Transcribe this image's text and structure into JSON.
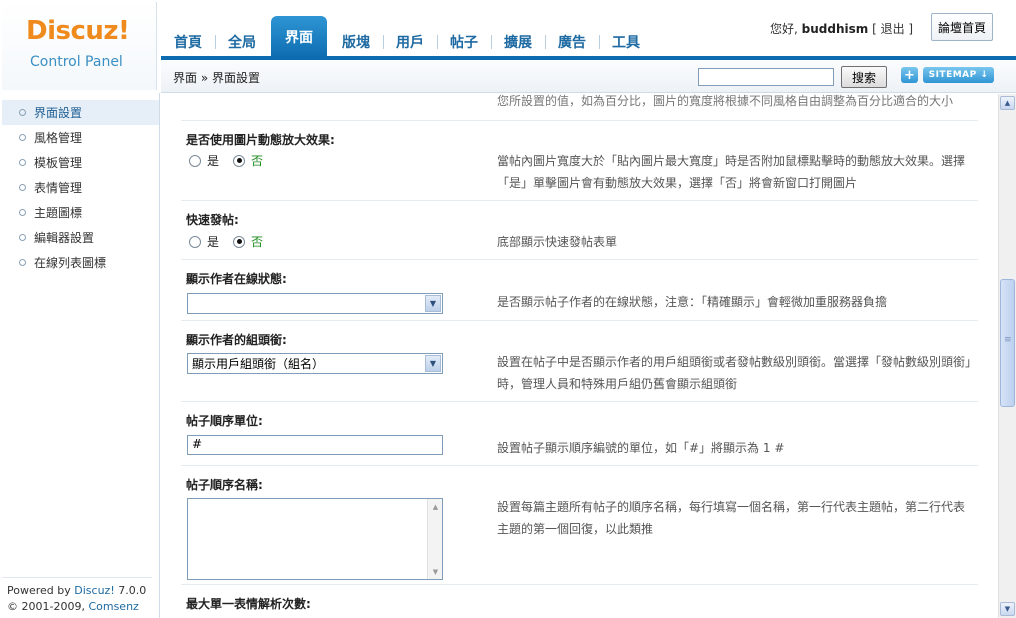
{
  "logo": {
    "word": "Discuz!",
    "subtitle": "Control Panel"
  },
  "nav": {
    "tabs": [
      {
        "label": "首頁"
      },
      {
        "label": "全局"
      },
      {
        "label": "界面",
        "active": true
      },
      {
        "label": "版塊"
      },
      {
        "label": "用戶"
      },
      {
        "label": "帖子"
      },
      {
        "label": "擴展"
      },
      {
        "label": "廣告"
      },
      {
        "label": "工具"
      }
    ]
  },
  "user": {
    "greeting": "您好, ",
    "username": "buddhism",
    "logout": "[ 退出 ]",
    "forum_home": "論壇首頁"
  },
  "breadcrumb": "界面 » 界面設置",
  "search": {
    "value": "",
    "button": "搜索"
  },
  "sitemap": {
    "plus": "+",
    "label": "SITEMAP ↓"
  },
  "sidebar": {
    "items": [
      {
        "label": "界面設置",
        "active": true
      },
      {
        "label": "風格管理"
      },
      {
        "label": "模板管理"
      },
      {
        "label": "表情管理"
      },
      {
        "label": "主題圖標"
      },
      {
        "label": "編輯器設置"
      },
      {
        "label": "在線列表圖標"
      }
    ],
    "footer": {
      "powered_prefix": "Powered by ",
      "powered_brand": "Discuz!",
      "powered_version": " 7.0.0",
      "copyright_prefix": "© 2001-2009, ",
      "copyright_brand": "Comsenz Inc."
    }
  },
  "settings": {
    "top_partial_desc": "您所設置的值，如為百分比，圖片的寬度將根據不同風格自由調整為百分比適合的大小",
    "dynamic_zoom": {
      "title": "是否使用圖片動態放大效果:",
      "yes": "是",
      "no": "否",
      "desc": "當帖內圖片寬度大於「貼內圖片最大寬度」時是否附加鼠標點擊時的動態放大效果。選擇「是」單擊圖片會有動態放大效果，選擇「否」將會新窗口打開圖片"
    },
    "quick_post": {
      "title": "快速發帖:",
      "yes": "是",
      "no": "否",
      "desc": "底部顯示快速發帖表單"
    },
    "online_status": {
      "title": "顯示作者在線狀態:",
      "value": "",
      "desc": "是否顯示帖子作者的在線狀態，注意：「精確顯示」會輕微加重服務器負擔"
    },
    "group_title": {
      "title": "顯示作者的組頭銜:",
      "value": "顯示用戶組頭銜（組名）",
      "desc": "設置在帖子中是否顯示作者的用戶組頭銜或者發帖數級別頭銜。當選擇「發帖數級別頭銜」時，管理人員和特殊用戶組仍舊會顯示組頭銜"
    },
    "post_unit": {
      "title": "帖子順序單位:",
      "value": "#",
      "desc": "設置帖子顯示順序編號的單位，如「#」將顯示為 1 #"
    },
    "post_names": {
      "title": "帖子順序名稱:",
      "value": "",
      "desc": "設置每篇主題所有帖子的順序名稱，每行填寫一個名稱，第一行代表主題帖，第二行代表主題的第一個回復，以此類推"
    },
    "max_smilies": {
      "title": "最大單一表情解析次數:"
    }
  }
}
